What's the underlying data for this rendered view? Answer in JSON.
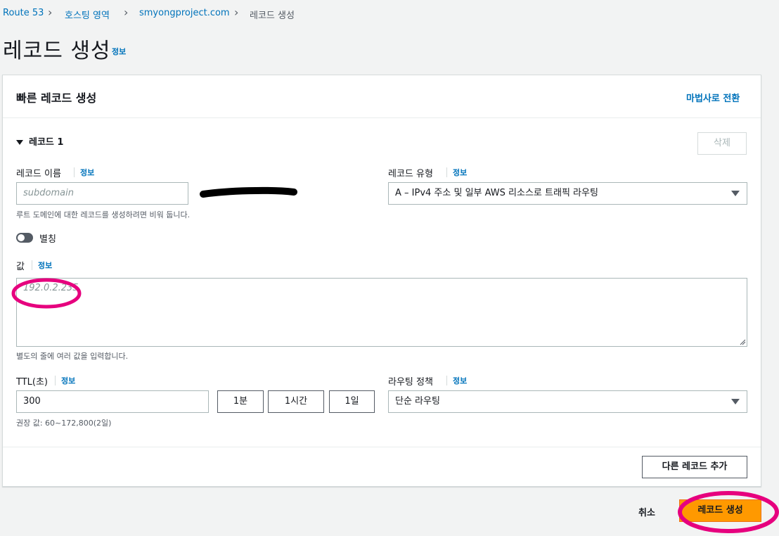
{
  "breadcrumb": {
    "items": [
      "Route 53",
      "호스팅 영역",
      "smyongproject.com"
    ],
    "current": "레코드 생성"
  },
  "page": {
    "title": "레코드 생성",
    "info_label": "정보"
  },
  "panel": {
    "title": "빠른 레코드 생성",
    "wizard_link": "마법사로 전환"
  },
  "record": {
    "section_title": "레코드 1",
    "delete_label": "삭제",
    "name": {
      "label": "레코드 이름",
      "info": "정보",
      "placeholder": "subdomain",
      "hint": "루트 도메인에 대한 레코드를 생성하려면 비워 둡니다."
    },
    "type": {
      "label": "레코드 유형",
      "info": "정보",
      "value": "A – IPv4 주소 및 일부 AWS 리소스로 트래픽 라우팅"
    },
    "alias": {
      "label": "별칭",
      "enabled": false
    },
    "value": {
      "label": "값",
      "info": "정보",
      "placeholder": "192.0.2.235",
      "hint": "별도의 줄에 여러 값을 입력합니다."
    },
    "ttl": {
      "label": "TTL(초)",
      "info": "정보",
      "value": "300",
      "presets": [
        "1분",
        "1시간",
        "1일"
      ],
      "hint": "권장 값: 60~172,800(2일)"
    },
    "routing": {
      "label": "라우팅 정책",
      "info": "정보",
      "value": "단순 라우팅"
    },
    "add_another_label": "다른 레코드 추가"
  },
  "footer": {
    "cancel_label": "취소",
    "create_label": "레코드 생성"
  },
  "colors": {
    "link": "#0073bb",
    "primary": "#ff9900",
    "annotation": "#e6007e"
  }
}
